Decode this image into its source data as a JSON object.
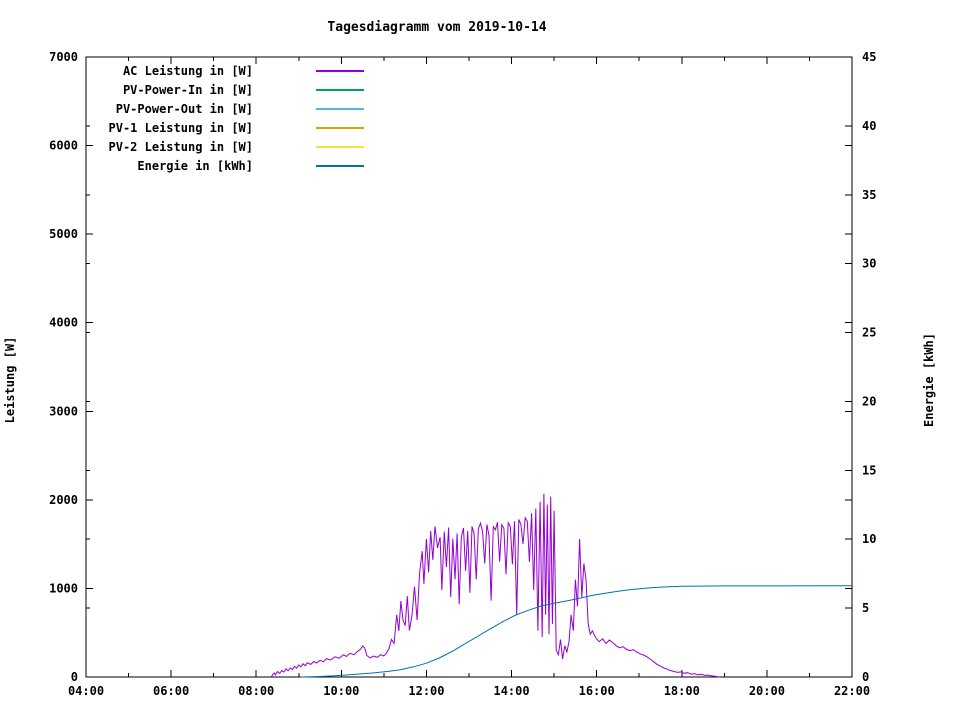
{
  "page": {
    "background": "#ffffff",
    "frame_color": "#000000",
    "text_color": "#000000"
  },
  "chart_data": {
    "type": "line",
    "title": "Tagesdiagramm vom 2019-10-14",
    "grid": false,
    "legend_position": "top-left",
    "x_axis": {
      "label": "",
      "unit": "time",
      "range_hours": [
        4,
        22
      ],
      "major_tick_hours": [
        4,
        6,
        8,
        10,
        12,
        14,
        16,
        18,
        20,
        22
      ],
      "minor_tick_hours": [
        5,
        7,
        9,
        11,
        13,
        15,
        17,
        19,
        21
      ],
      "tick_labels": [
        "04:00",
        "06:00",
        "08:00",
        "10:00",
        "12:00",
        "14:00",
        "16:00",
        "18:00",
        "20:00",
        "22:00"
      ]
    },
    "y_axis": {
      "label": "Leistung [W]",
      "range": [
        0,
        7000
      ],
      "ticks": [
        0,
        1000,
        2000,
        3000,
        4000,
        5000,
        6000,
        7000
      ],
      "tick_labels": [
        "0",
        "1000",
        "2000",
        "3000",
        "4000",
        "5000",
        "6000",
        "7000"
      ]
    },
    "y2_axis": {
      "label": "Energie [kWh]",
      "range": [
        0,
        45
      ],
      "ticks": [
        0,
        5,
        10,
        15,
        20,
        25,
        30,
        35,
        40,
        45
      ],
      "tick_labels": [
        "0",
        "5",
        "10",
        "15",
        "20",
        "25",
        "30",
        "35",
        "40",
        "45"
      ]
    },
    "series": [
      {
        "id": "ac-leistung",
        "name": "AC Leistung in [W]",
        "color": "#9400d3",
        "axis": "y1",
        "points": [
          [
            8.35,
            0
          ],
          [
            8.38,
            20
          ],
          [
            8.42,
            45
          ],
          [
            8.45,
            25
          ],
          [
            8.5,
            62
          ],
          [
            8.55,
            40
          ],
          [
            8.6,
            72
          ],
          [
            8.65,
            55
          ],
          [
            8.7,
            92
          ],
          [
            8.75,
            70
          ],
          [
            8.8,
            102
          ],
          [
            8.85,
            85
          ],
          [
            8.9,
            120
          ],
          [
            8.95,
            100
          ],
          [
            9.0,
            135
          ],
          [
            9.05,
            115
          ],
          [
            9.1,
            150
          ],
          [
            9.15,
            128
          ],
          [
            9.2,
            160
          ],
          [
            9.28,
            142
          ],
          [
            9.35,
            175
          ],
          [
            9.42,
            158
          ],
          [
            9.5,
            190
          ],
          [
            9.58,
            172
          ],
          [
            9.65,
            208
          ],
          [
            9.75,
            192
          ],
          [
            9.85,
            228
          ],
          [
            9.95,
            212
          ],
          [
            10.05,
            250
          ],
          [
            10.12,
            232
          ],
          [
            10.2,
            268
          ],
          [
            10.3,
            252
          ],
          [
            10.38,
            290
          ],
          [
            10.45,
            312
          ],
          [
            10.5,
            350
          ],
          [
            10.55,
            328
          ],
          [
            10.6,
            242
          ],
          [
            10.68,
            215
          ],
          [
            10.75,
            236
          ],
          [
            10.85,
            222
          ],
          [
            10.92,
            252
          ],
          [
            11.0,
            238
          ],
          [
            11.05,
            262
          ],
          [
            11.12,
            318
          ],
          [
            11.18,
            424
          ],
          [
            11.24,
            378
          ],
          [
            11.3,
            702
          ],
          [
            11.35,
            520
          ],
          [
            11.4,
            858
          ],
          [
            11.45,
            640
          ],
          [
            11.5,
            582
          ],
          [
            11.55,
            912
          ],
          [
            11.6,
            524
          ],
          [
            11.66,
            700
          ],
          [
            11.72,
            1022
          ],
          [
            11.78,
            642
          ],
          [
            11.84,
            1178
          ],
          [
            11.9,
            1420
          ],
          [
            11.94,
            1052
          ],
          [
            12.0,
            1558
          ],
          [
            12.05,
            1182
          ],
          [
            12.1,
            1648
          ],
          [
            12.15,
            1322
          ],
          [
            12.2,
            1702
          ],
          [
            12.26,
            1458
          ],
          [
            12.32,
            1580
          ],
          [
            12.36,
            982
          ],
          [
            12.42,
            1640
          ],
          [
            12.47,
            1242
          ],
          [
            12.52,
            1688
          ],
          [
            12.57,
            902
          ],
          [
            12.62,
            1562
          ],
          [
            12.67,
            1102
          ],
          [
            12.72,
            1620
          ],
          [
            12.77,
            820
          ],
          [
            12.82,
            1578
          ],
          [
            12.87,
            1682
          ],
          [
            12.92,
            1198
          ],
          [
            12.97,
            1650
          ],
          [
            13.02,
            952
          ],
          [
            13.07,
            1700
          ],
          [
            13.12,
            1618
          ],
          [
            13.17,
            1102
          ],
          [
            13.22,
            1678
          ],
          [
            13.27,
            1738
          ],
          [
            13.32,
            1640
          ],
          [
            13.37,
            1282
          ],
          [
            13.42,
            1722
          ],
          [
            13.47,
            1598
          ],
          [
            13.52,
            862
          ],
          [
            13.57,
            1698
          ],
          [
            13.62,
            1662
          ],
          [
            13.67,
            1748
          ],
          [
            13.72,
            1302
          ],
          [
            13.77,
            1720
          ],
          [
            13.82,
            1678
          ],
          [
            13.87,
            1158
          ],
          [
            13.92,
            1740
          ],
          [
            13.97,
            1698
          ],
          [
            14.02,
            1272
          ],
          [
            14.07,
            1758
          ],
          [
            14.12,
            702
          ],
          [
            14.17,
            1778
          ],
          [
            14.22,
            1722
          ],
          [
            14.27,
            1502
          ],
          [
            14.32,
            1798
          ],
          [
            14.37,
            1758
          ],
          [
            14.42,
            1298
          ],
          [
            14.47,
            1848
          ],
          [
            14.52,
            982
          ],
          [
            14.57,
            1902
          ],
          [
            14.62,
            522
          ],
          [
            14.67,
            1978
          ],
          [
            14.72,
            452
          ],
          [
            14.76,
            2068
          ],
          [
            14.8,
            702
          ],
          [
            14.84,
            1948
          ],
          [
            14.88,
            482
          ],
          [
            14.92,
            2038
          ],
          [
            14.96,
            598
          ],
          [
            15.0,
            1878
          ],
          [
            15.05,
            302
          ],
          [
            15.1,
            252
          ],
          [
            15.15,
            422
          ],
          [
            15.2,
            202
          ],
          [
            15.25,
            352
          ],
          [
            15.3,
            282
          ],
          [
            15.35,
            398
          ],
          [
            15.4,
            702
          ],
          [
            15.45,
            522
          ],
          [
            15.5,
            1098
          ],
          [
            15.55,
            798
          ],
          [
            15.6,
            1558
          ],
          [
            15.65,
            902
          ],
          [
            15.7,
            1282
          ],
          [
            15.75,
            1098
          ],
          [
            15.8,
            598
          ],
          [
            15.85,
            482
          ],
          [
            15.9,
            522
          ],
          [
            15.98,
            442
          ],
          [
            16.06,
            398
          ],
          [
            16.14,
            432
          ],
          [
            16.22,
            378
          ],
          [
            16.3,
            418
          ],
          [
            16.38,
            388
          ],
          [
            16.46,
            352
          ],
          [
            16.54,
            330
          ],
          [
            16.62,
            342
          ],
          [
            16.7,
            312
          ],
          [
            16.78,
            298
          ],
          [
            16.86,
            308
          ],
          [
            16.94,
            282
          ],
          [
            17.02,
            262
          ],
          [
            17.1,
            248
          ],
          [
            17.18,
            228
          ],
          [
            17.26,
            202
          ],
          [
            17.34,
            172
          ],
          [
            17.42,
            142
          ],
          [
            17.5,
            122
          ],
          [
            17.58,
            102
          ],
          [
            17.66,
            88
          ],
          [
            17.74,
            72
          ],
          [
            17.82,
            62
          ],
          [
            17.9,
            52
          ],
          [
            17.98,
            58
          ],
          [
            18.06,
            42
          ],
          [
            18.14,
            48
          ],
          [
            18.22,
            32
          ],
          [
            18.3,
            38
          ],
          [
            18.38,
            25
          ],
          [
            18.46,
            30
          ],
          [
            18.54,
            18
          ],
          [
            18.62,
            22
          ],
          [
            18.7,
            12
          ],
          [
            18.78,
            8
          ],
          [
            18.85,
            3
          ],
          [
            18.9,
            0
          ]
        ]
      },
      {
        "id": "pv-power-in",
        "name": "PV-Power-In in [W]",
        "color": "#009e73",
        "axis": "y1",
        "points": []
      },
      {
        "id": "pv-power-out",
        "name": "PV-Power-Out in [W]",
        "color": "#56b4e9",
        "axis": "y1",
        "points": []
      },
      {
        "id": "pv1-leistung",
        "name": "PV-1 Leistung in [W]",
        "color": "#e69f00",
        "axis": "y1",
        "points": []
      },
      {
        "id": "pv2-leistung",
        "name": "PV-2 Leistung in [W]",
        "color": "#f0e442",
        "axis": "y1",
        "points": []
      },
      {
        "id": "energie",
        "name": "Energie in [kWh]",
        "color": "#0072b2",
        "axis": "y2",
        "points": [
          [
            9.05,
            0
          ],
          [
            9.3,
            0.02
          ],
          [
            9.6,
            0.05
          ],
          [
            9.9,
            0.1
          ],
          [
            10.2,
            0.16
          ],
          [
            10.5,
            0.23
          ],
          [
            10.8,
            0.31
          ],
          [
            11.1,
            0.41
          ],
          [
            11.4,
            0.54
          ],
          [
            11.7,
            0.74
          ],
          [
            12.0,
            1.0
          ],
          [
            12.3,
            1.38
          ],
          [
            12.6,
            1.85
          ],
          [
            12.9,
            2.4
          ],
          [
            13.2,
            2.95
          ],
          [
            13.5,
            3.5
          ],
          [
            13.8,
            4.02
          ],
          [
            14.1,
            4.5
          ],
          [
            14.4,
            4.85
          ],
          [
            14.7,
            5.15
          ],
          [
            15.0,
            5.35
          ],
          [
            15.3,
            5.52
          ],
          [
            15.6,
            5.72
          ],
          [
            15.9,
            5.92
          ],
          [
            16.2,
            6.08
          ],
          [
            16.5,
            6.22
          ],
          [
            16.8,
            6.34
          ],
          [
            17.1,
            6.43
          ],
          [
            17.4,
            6.5
          ],
          [
            17.7,
            6.55
          ],
          [
            18.0,
            6.58
          ],
          [
            18.4,
            6.6
          ],
          [
            19.0,
            6.61
          ],
          [
            22.0,
            6.62
          ]
        ]
      }
    ]
  }
}
